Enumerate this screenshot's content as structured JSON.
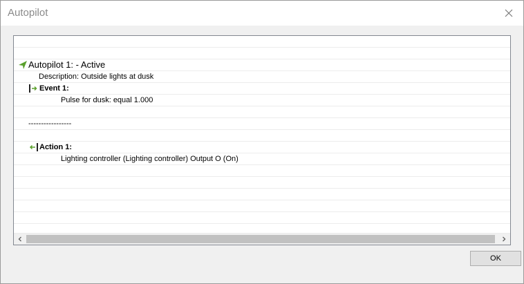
{
  "window": {
    "title": "Autopilot",
    "close_icon": "close-icon"
  },
  "autopilot": {
    "header": "Autopilot 1: -  Active",
    "header_icon": "green-arrow-icon",
    "description": "Description: Outside lights at dusk",
    "event_label": "Event 1:",
    "event_icon": "event-arrow-icon",
    "event_detail": "Pulse for dusk: equal 1.000",
    "separator": "-----------------",
    "action_label": "Action 1:",
    "action_icon": "action-arrow-icon",
    "action_detail": "Lighting controller (Lighting controller)  Output O (On)"
  },
  "scrollbar": {
    "left_icon": "scroll-left-icon",
    "right_icon": "scroll-right-icon"
  },
  "buttons": {
    "ok_label": "OK"
  },
  "colors": {
    "accent_green": "#5aa02c",
    "title_gray": "#8a8a8a"
  }
}
